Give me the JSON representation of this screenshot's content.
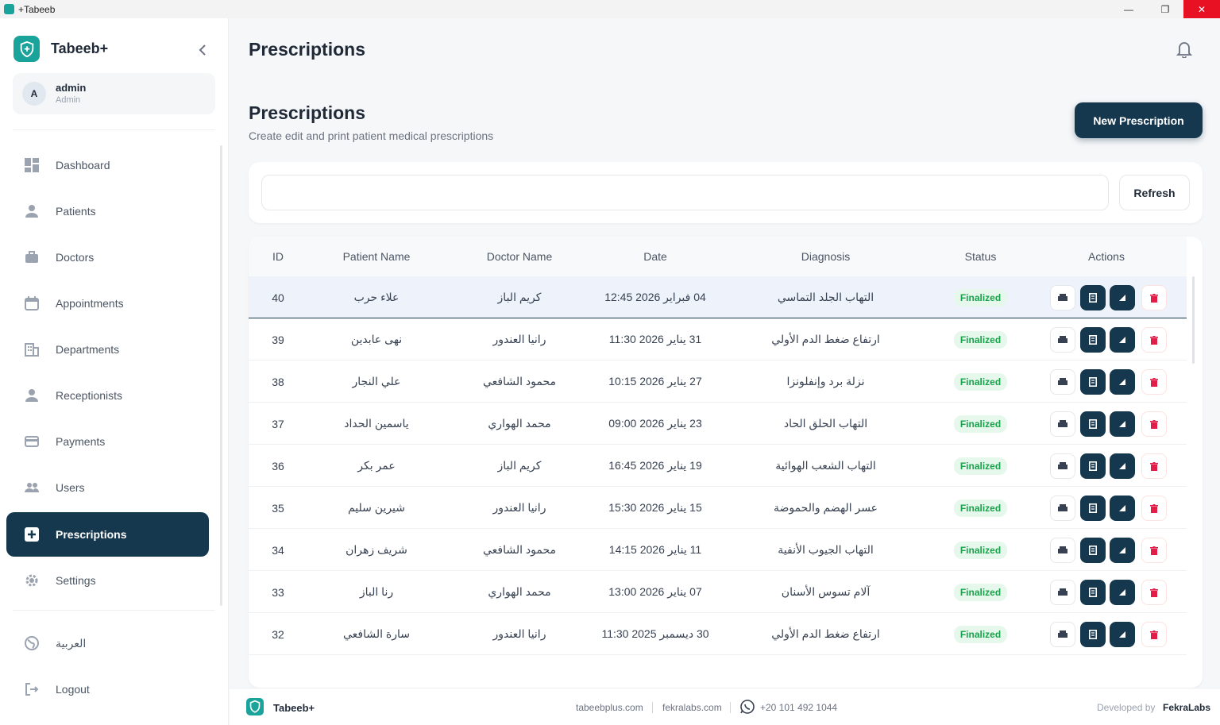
{
  "window": {
    "title": "+Tabeeb"
  },
  "brand": {
    "name": "Tabeeb+"
  },
  "user": {
    "initial": "A",
    "name": "admin",
    "role": "Admin"
  },
  "nav": [
    {
      "label": "Dashboard",
      "icon": "dashboard-icon"
    },
    {
      "label": "Patients",
      "icon": "person-icon"
    },
    {
      "label": "Doctors",
      "icon": "briefcase-icon"
    },
    {
      "label": "Appointments",
      "icon": "calendar-icon"
    },
    {
      "label": "Departments",
      "icon": "building-icon"
    },
    {
      "label": "Receptionists",
      "icon": "person-icon"
    },
    {
      "label": "Payments",
      "icon": "card-icon"
    },
    {
      "label": "Users",
      "icon": "group-icon"
    },
    {
      "label": "Prescriptions",
      "icon": "plus-box-icon",
      "active": true
    },
    {
      "label": "Settings",
      "icon": "gear-icon"
    }
  ],
  "nav_bottom": [
    {
      "label": "العربية",
      "icon": "globe-icon"
    },
    {
      "label": "Logout",
      "icon": "logout-icon"
    }
  ],
  "page": {
    "title": "Prescriptions",
    "section_title": "Prescriptions",
    "section_subtitle": "Create edit and print patient medical prescriptions",
    "new_button": "New Prescription",
    "refresh_button": "Refresh",
    "search_value": ""
  },
  "table": {
    "columns": [
      "ID",
      "Patient Name",
      "Doctor Name",
      "Date",
      "Diagnosis",
      "Status",
      "Actions"
    ],
    "rows": [
      {
        "id": "40",
        "patient": "علاء حرب",
        "doctor": "كريم الباز",
        "date": "04 فبراير 2026 12:45",
        "diagnosis": "التهاب الجلد التماسي",
        "status": "Finalized",
        "selected": true
      },
      {
        "id": "39",
        "patient": "نهى عابدين",
        "doctor": "رانيا العندور",
        "date": "31 يناير 2026 11:30",
        "diagnosis": "ارتفاع ضغط الدم الأولي",
        "status": "Finalized"
      },
      {
        "id": "38",
        "patient": "علي النجار",
        "doctor": "محمود الشافعي",
        "date": "27 يناير 2026 10:15",
        "diagnosis": "نزلة برد وإنفلونزا",
        "status": "Finalized"
      },
      {
        "id": "37",
        "patient": "ياسمين الحداد",
        "doctor": "محمد الهواري",
        "date": "23 يناير 2026 09:00",
        "diagnosis": "التهاب الحلق الحاد",
        "status": "Finalized"
      },
      {
        "id": "36",
        "patient": "عمر بكر",
        "doctor": "كريم الباز",
        "date": "19 يناير 2026 16:45",
        "diagnosis": "التهاب الشعب الهوائية",
        "status": "Finalized"
      },
      {
        "id": "35",
        "patient": "شيرين سليم",
        "doctor": "رانيا العندور",
        "date": "15 يناير 2026 15:30",
        "diagnosis": "عسر الهضم والحموضة",
        "status": "Finalized"
      },
      {
        "id": "34",
        "patient": "شريف زهران",
        "doctor": "محمود الشافعي",
        "date": "11 يناير 2026 14:15",
        "diagnosis": "التهاب الجيوب الأنفية",
        "status": "Finalized"
      },
      {
        "id": "33",
        "patient": "رنا الباز",
        "doctor": "محمد الهواري",
        "date": "07 يناير 2026 13:00",
        "diagnosis": "آلام تسوس الأسنان",
        "status": "Finalized"
      },
      {
        "id": "32",
        "patient": "سارة الشافعي",
        "doctor": "رانيا العندور",
        "date": "30 ديسمبر 2025 11:30",
        "diagnosis": "ارتفاع ضغط الدم الأولي",
        "status": "Finalized"
      }
    ]
  },
  "footer": {
    "brand": "Tabeeb+",
    "site1": "tabeebplus.com",
    "site2": "fekralabs.com",
    "phone": "+20 101 492 1044",
    "developed_by": "Developed by",
    "developer": "FekraLabs"
  },
  "colors": {
    "primary": "#16384f",
    "accent": "#1aa39b",
    "success": "#17a34a",
    "danger": "#e11d48"
  }
}
